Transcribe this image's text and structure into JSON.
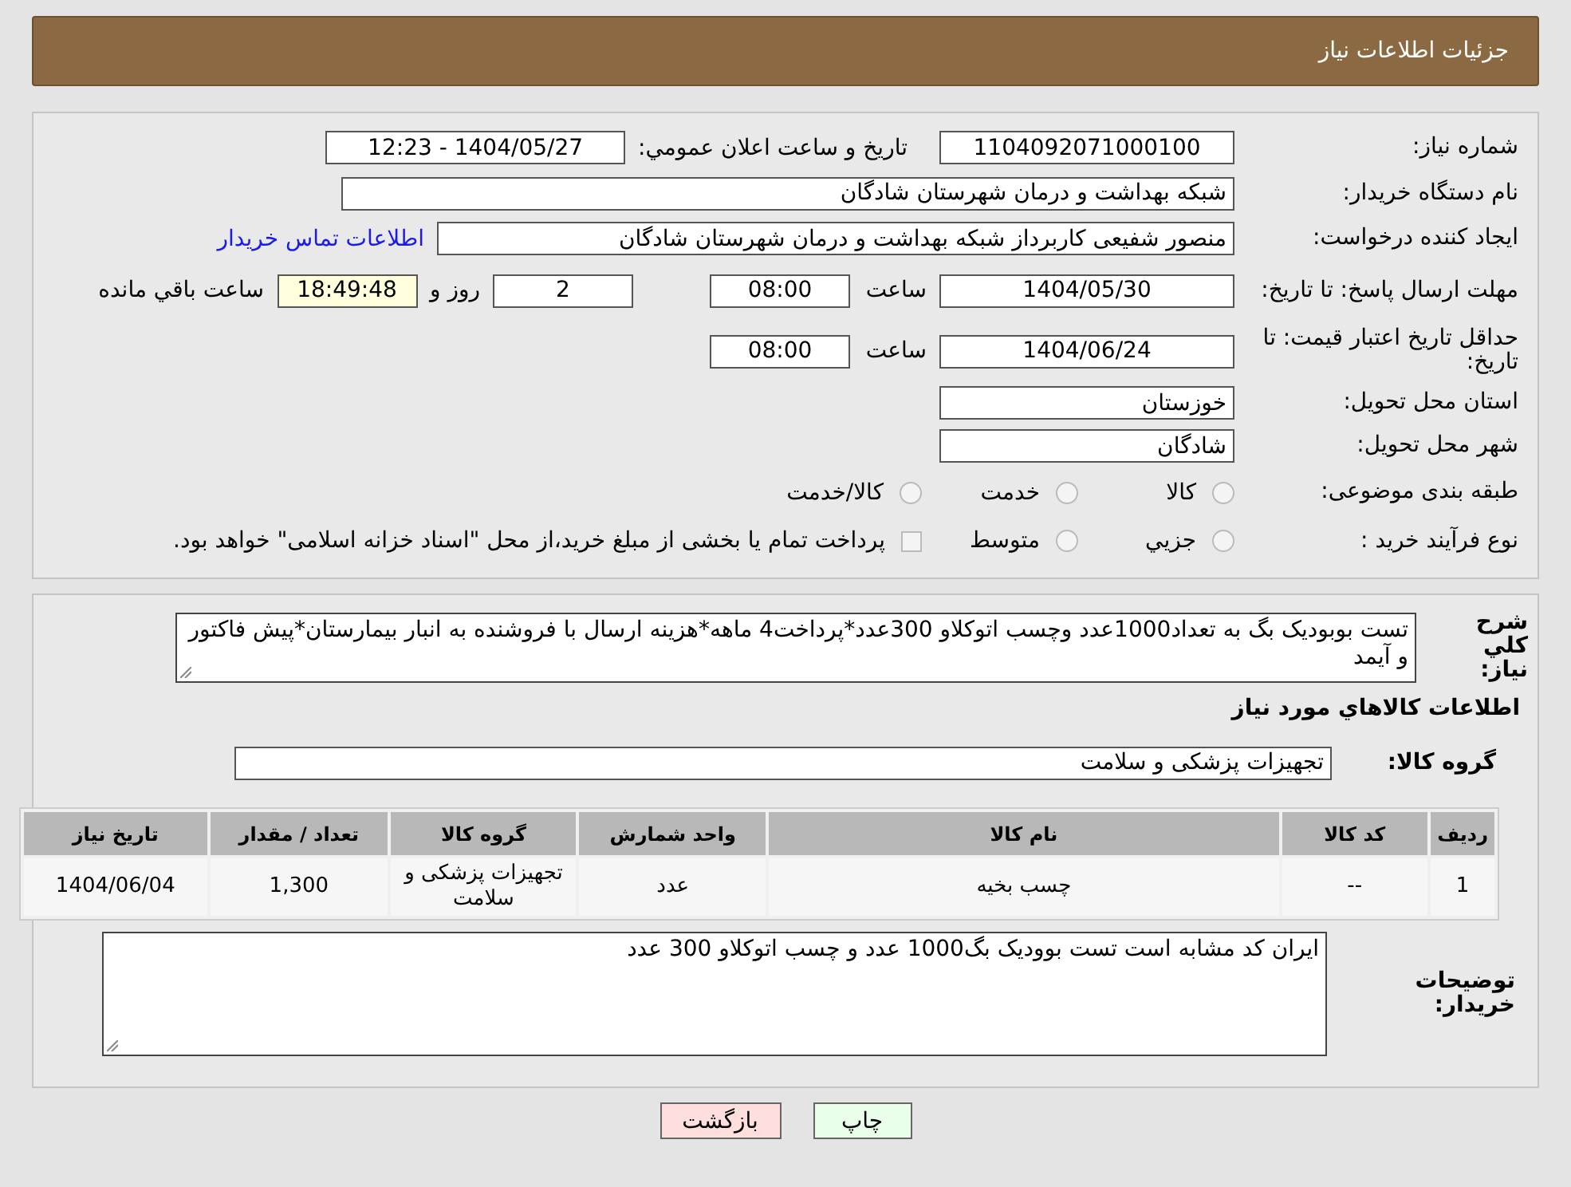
{
  "header": {
    "title": "جزئیات اطلاعات نیاز"
  },
  "need_number": {
    "label": "شماره نیاز:",
    "value": "1104092071000100"
  },
  "announce": {
    "label": "تاریخ و ساعت اعلان عمومي:",
    "value": "1404/05/27 - 12:23"
  },
  "buyer": {
    "label": "نام دستگاه خریدار:",
    "value": "شبکه بهداشت و درمان شهرستان شادگان"
  },
  "creator": {
    "label": "ایجاد کننده درخواست:",
    "value": "منصور شفیعی کاربرداز شبکه بهداشت و درمان شهرستان شادگان",
    "link": "اطلاعات تماس خریدار"
  },
  "deadline": {
    "label": "مهلت ارسال پاسخ: تا تاریخ:",
    "date": "1404/05/30",
    "time_label": "ساعت",
    "time": "08:00",
    "days": "2",
    "days_label": "روز و",
    "remaining": "18:49:48",
    "remaining_label": "ساعت باقي مانده"
  },
  "validity": {
    "label": "حداقل تاریخ اعتبار قیمت: تا تاریخ:",
    "date": "1404/06/24",
    "time_label": "ساعت",
    "time": "08:00"
  },
  "province": {
    "label": "استان محل تحویل:",
    "value": "خوزستان"
  },
  "city": {
    "label": "شهر محل تحویل:",
    "value": "شادگان"
  },
  "category": {
    "label": "طبقه بندی موضوعی:",
    "options": [
      {
        "label": "کالا",
        "selected": false
      },
      {
        "label": "خدمت",
        "selected": false
      },
      {
        "label": "کالا/خدمت",
        "selected": false
      }
    ]
  },
  "purchase_type": {
    "label": "نوع فرآیند خرید :",
    "options": [
      {
        "kind": "radio",
        "label": "جزيي",
        "selected": false
      },
      {
        "kind": "radio",
        "label": "متوسط",
        "selected": false
      },
      {
        "kind": "checkbox",
        "label": "پرداخت تمام یا بخشی از مبلغ خرید،از محل \"اسناد خزانه اسلامی\" خواهد بود.",
        "selected": false
      }
    ]
  },
  "description": {
    "label": "شرح کلي نیاز:",
    "value": "تست بوبودیک بگ به تعداد1000عدد وچسب اتوکلاو 300عدد*پرداخت4 ماهه*هزینه ارسال با فروشنده به انبار بیمارستان*پیش فاکتور و آیمد"
  },
  "goods_title": "اطلاعات کالاهاي مورد نیاز",
  "goods_group": {
    "label": "گروه کالا:",
    "value": "تجهیزات پزشکی و سلامت"
  },
  "table": {
    "columns": [
      "ردیف",
      "کد کالا",
      "نام کالا",
      "واحد شمارش",
      "گروه کالا",
      "تعداد / مقدار",
      "تاریخ نیاز"
    ],
    "rows": [
      [
        "1",
        "--",
        "چسب بخیه",
        "عدد",
        "تجهیزات پزشکی و سلامت",
        "1,300",
        "1404/06/04"
      ]
    ]
  },
  "buyer_notes": {
    "label": "توضیحات خریدار:",
    "value": "ایران کد مشابه است تست بوودیک بگ1000 عدد و چسب اتوکلاو 300 عدد"
  },
  "buttons": [
    {
      "kind": "print",
      "label": "چاپ"
    },
    {
      "kind": "back",
      "label": "بازگشت"
    }
  ]
}
